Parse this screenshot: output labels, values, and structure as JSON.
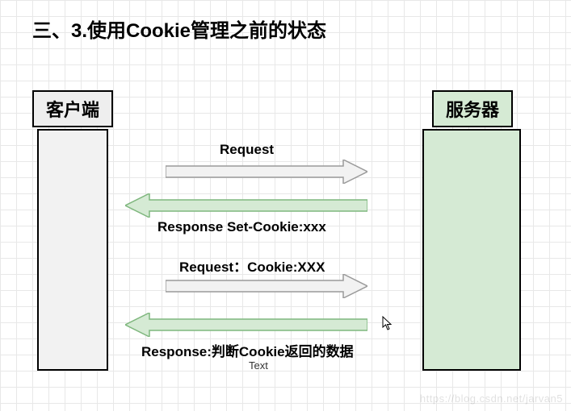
{
  "title": "三、3.使用Cookie管理之前的状态",
  "client_label": "客户端",
  "server_label": "服务器",
  "arrows": {
    "req1": "Request",
    "resp1": "Response Set-Cookie:xxx",
    "req2": "Request：Cookie:XXX",
    "resp2": "Response:判断Cookie返回的数据"
  },
  "text_label": "Text",
  "watermark": "https://blog.csdn.net/jarvan5",
  "colors": {
    "grey_fill": "#f2f2f2",
    "grey_stroke": "#9a9a9a",
    "green_fill": "#d5ead4",
    "green_stroke": "#7fb77e"
  }
}
